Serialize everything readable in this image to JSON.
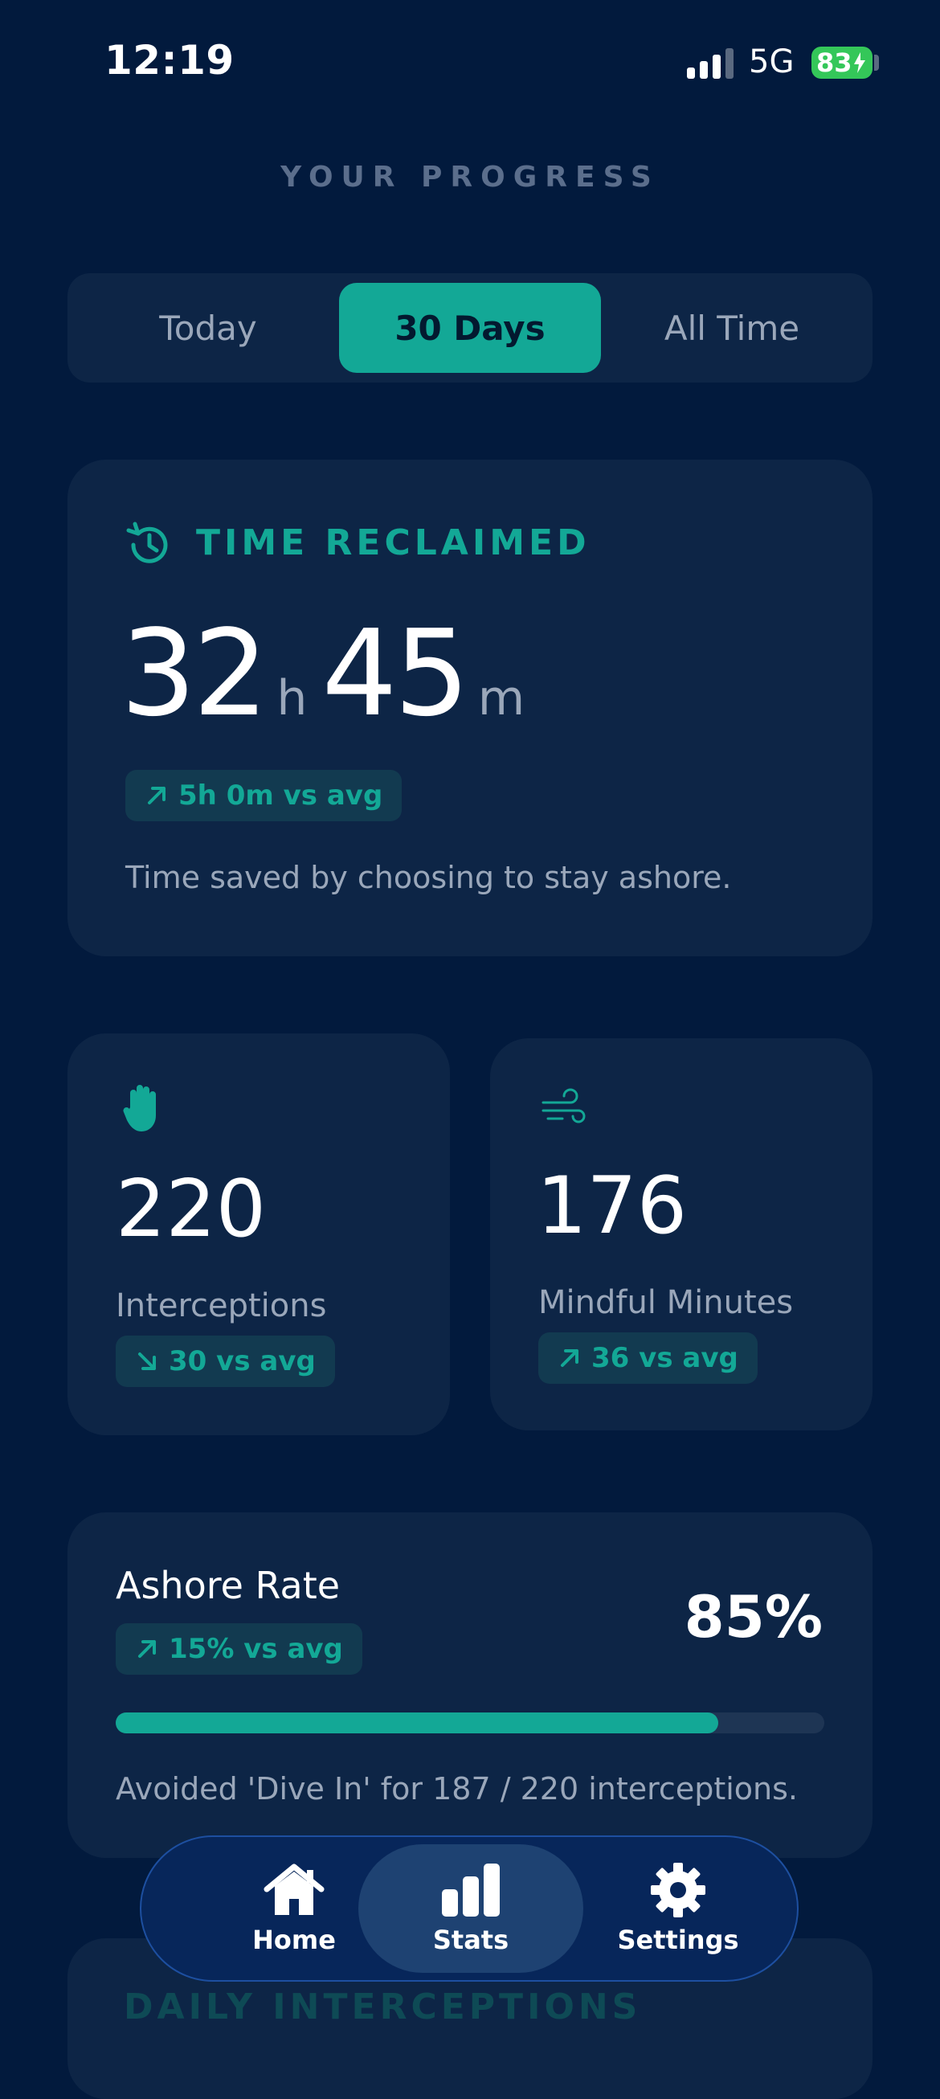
{
  "status_bar": {
    "time": "12:19",
    "network": "5G",
    "battery": "83"
  },
  "page_title": "YOUR PROGRESS",
  "segmented": {
    "options": [
      "Today",
      "30 Days",
      "All Time"
    ],
    "selected": "30 Days"
  },
  "time_reclaimed": {
    "title": "TIME RECLAIMED",
    "hours": "32",
    "hours_unit": "h",
    "minutes": "45",
    "minutes_unit": "m",
    "delta": "5h 0m vs avg",
    "delta_direction": "up",
    "caption": "Time saved by choosing to stay ashore."
  },
  "interceptions": {
    "value": "220",
    "label": "Interceptions",
    "delta": "30 vs avg",
    "delta_direction": "down",
    "icon": "hand-icon"
  },
  "mindful": {
    "value": "176",
    "label": "Mindful Minutes",
    "delta": "36 vs avg",
    "delta_direction": "up",
    "icon": "wind-icon"
  },
  "ashore_rate": {
    "title": "Ashore Rate",
    "value": "85%",
    "progress": 0.85,
    "delta": "15% vs avg",
    "delta_direction": "up",
    "caption": "Avoided 'Dive In' for 187 / 220 interceptions."
  },
  "daily_section_title": "DAILY INTERCEPTIONS",
  "nav": {
    "items": [
      {
        "label": "Home",
        "icon": "home-icon"
      },
      {
        "label": "Stats",
        "icon": "stats-icon"
      },
      {
        "label": "Settings",
        "icon": "gear-icon"
      }
    ],
    "active": "Stats"
  },
  "colors": {
    "background": "#021a3d",
    "card": "#0d2546",
    "accent": "#13a896",
    "muted": "#9aa7ba"
  }
}
